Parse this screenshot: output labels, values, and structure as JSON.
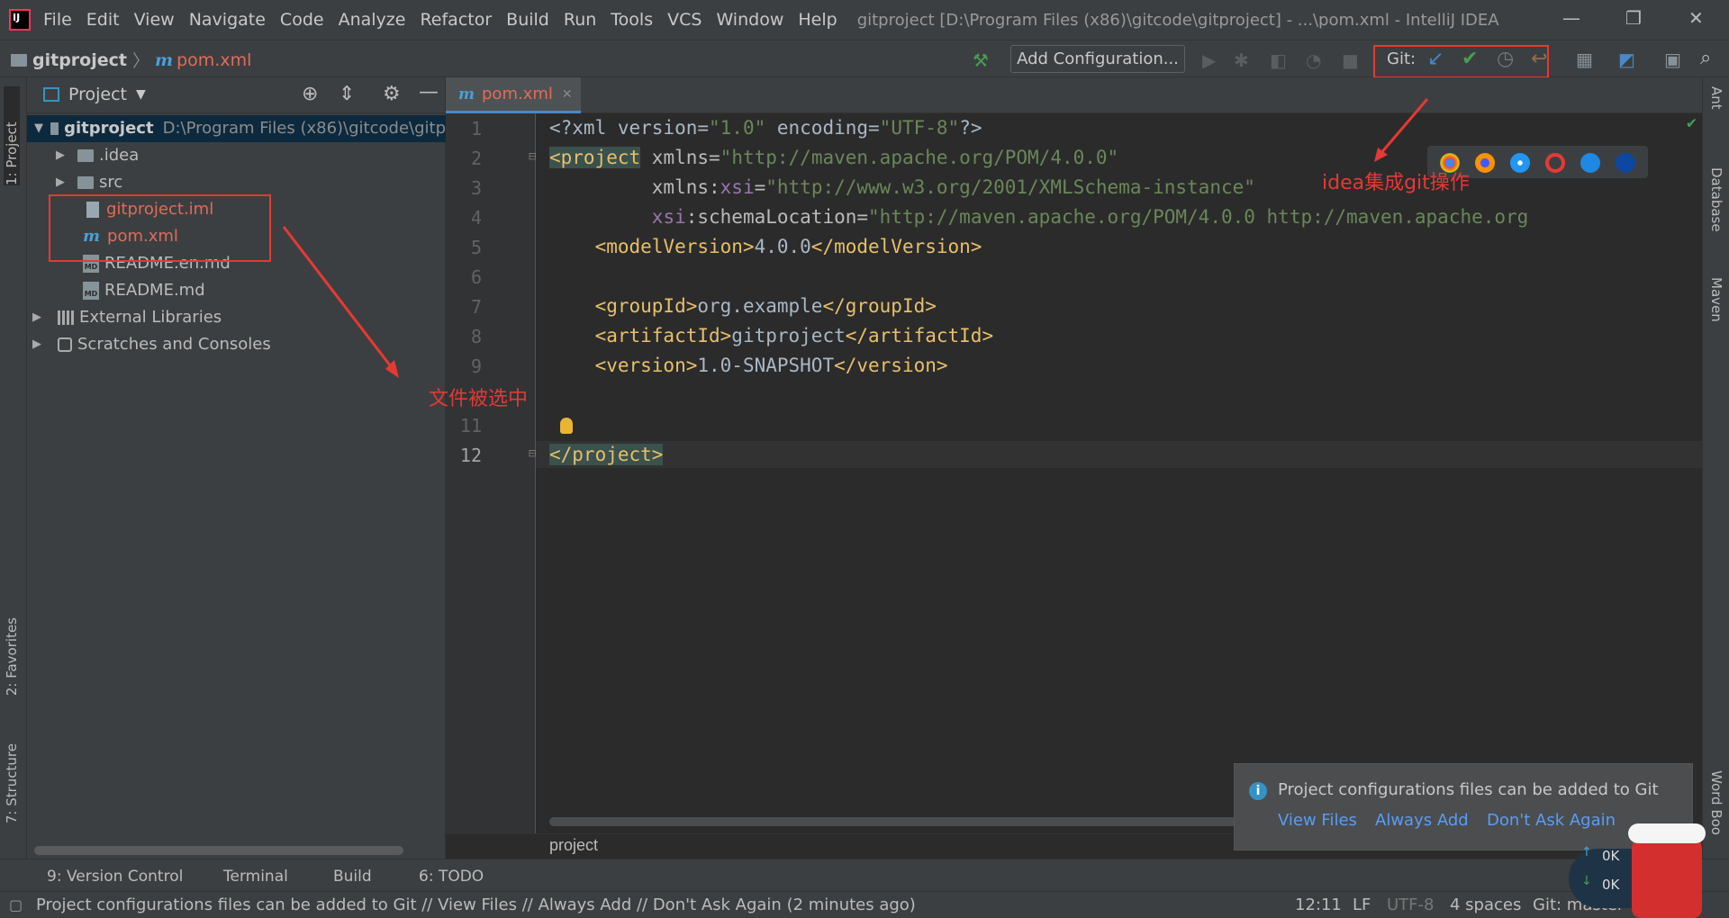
{
  "menubar": {
    "items": [
      "File",
      "Edit",
      "View",
      "Navigate",
      "Code",
      "Analyze",
      "Refactor",
      "Build",
      "Run",
      "Tools",
      "VCS",
      "Window",
      "Help"
    ],
    "window_title": "gitproject [D:\\Program Files (x86)\\gitcode\\gitproject] - ...\\pom.xml - IntelliJ IDEA"
  },
  "navbar": {
    "project": "gitproject",
    "file": "pom.xml",
    "add_configuration": "Add Configuration...",
    "git_label": "Git:"
  },
  "left_strip": {
    "project": "1: Project",
    "favorites": "2: Favorites",
    "structure": "7: Structure"
  },
  "project_panel": {
    "title": "Project",
    "tree": [
      {
        "label": "gitproject",
        "path": "D:\\Program Files (x86)\\gitcode\\gitp"
      },
      {
        "label": ".idea"
      },
      {
        "label": "src"
      },
      {
        "label": "gitproject.iml"
      },
      {
        "label": "pom.xml"
      },
      {
        "label": "README.en.md"
      },
      {
        "label": "README.md"
      },
      {
        "label": "External Libraries"
      },
      {
        "label": "Scratches and Consoles"
      }
    ]
  },
  "editor": {
    "tab": "pom.xml",
    "line_numbers": [
      "1",
      "2",
      "3",
      "4",
      "5",
      "6",
      "7",
      "8",
      "9",
      "11",
      "12"
    ],
    "lines": {
      "l1_a": "<?xml version=",
      "l1_b": "\"1.0\"",
      "l1_c": " encoding=",
      "l1_d": "\"UTF-8\"",
      "l1_e": "?>",
      "l2_a": "<project",
      "l2_b": " xmlns=",
      "l2_c": "\"http://maven.apache.org/POM/4.0.0\"",
      "l3_a": "         xmlns:",
      "l3_b": "xsi",
      "l3_c": "=",
      "l3_d": "\"http://www.w3.org/2001/XMLSchema-instance\"",
      "l4_a": "         ",
      "l4_b": "xsi",
      "l4_c": ":schemaLocation=",
      "l4_d": "\"http://maven.apache.org/POM/4.0.0 http://maven.apache.org",
      "l5_a": "    <modelVersion>",
      "l5_b": "4.0.0",
      "l5_c": "</modelVersion>",
      "l7_a": "    <groupId>",
      "l7_b": "org.example",
      "l7_c": "</groupId>",
      "l8_a": "    <artifactId>",
      "l8_b": "gitproject",
      "l8_c": "</artifactId>",
      "l9_a": "    <version>",
      "l9_b": "1.0-SNAPSHOT",
      "l9_c": "</version>",
      "l12": "</project>"
    },
    "breadcrumb": "project"
  },
  "right_strip": {
    "ant": "Ant",
    "database": "Database",
    "maven": "Maven",
    "word_book": "Word Boo"
  },
  "notification": {
    "text": "Project configurations files can be added to Git",
    "links": [
      "View Files",
      "Always Add",
      "Don't Ask Again"
    ]
  },
  "bottom_tools": {
    "version_control": "9: Version Control",
    "terminal": "Terminal",
    "build": "Build",
    "todo": "6: TODO"
  },
  "status": {
    "message": "Project configurations files can be added to Git // View Files // Always Add // Don't Ask Again (2 minutes ago)",
    "position": "12:11",
    "line_sep": "LF",
    "encoding": "UTF-8",
    "indent": "4 spaces",
    "git_branch": "Git: master"
  },
  "annotations": {
    "file_selected": "文件被选中",
    "git_integration": "idea集成git操作"
  },
  "widget": {
    "up": "0K",
    "down": "0K"
  },
  "colors": {
    "accent": "#4a88c7",
    "annotation": "#e53935",
    "link": "#589df6",
    "selected_file": "#e06c5a"
  }
}
